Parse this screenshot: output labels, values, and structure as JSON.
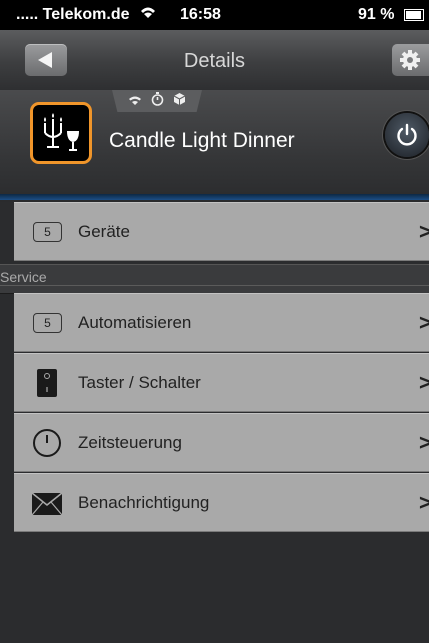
{
  "status_bar": {
    "carrier": "..... Telekom.de",
    "time": "16:58",
    "battery": "91 %"
  },
  "navbar": {
    "title": "Details",
    "back_icon": "back-arrow-icon",
    "settings_icon": "gear-icon"
  },
  "scene": {
    "title": "Candle Light Dinner",
    "icon": "candelabra-wineglass-icon",
    "accent_color": "#f0952a",
    "tab_icons": [
      "wifi-icon",
      "timer-icon",
      "cube-icon"
    ]
  },
  "devices_row": {
    "count": "5",
    "label": "Geräte",
    "chevron": ">"
  },
  "section": {
    "label": "Service"
  },
  "service_items": [
    {
      "label": "Automatisieren",
      "count": "5",
      "icon": "count-badge",
      "chevron": ">"
    },
    {
      "label": "Taster / Schalter",
      "icon": "switch-icon",
      "chevron": ">"
    },
    {
      "label": "Zeitsteuerung",
      "icon": "clock-icon",
      "chevron": ">"
    },
    {
      "label": "Benachrichtigung",
      "icon": "envelope-icon",
      "chevron": ">"
    }
  ]
}
